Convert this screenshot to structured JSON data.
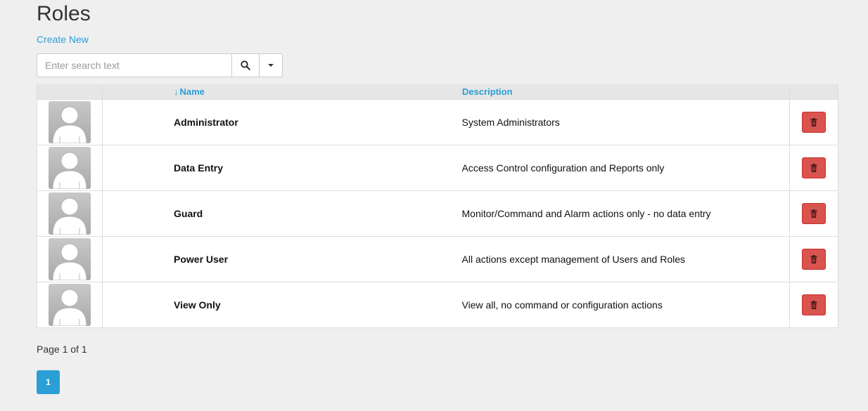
{
  "page": {
    "title": "Roles",
    "create_label": "Create New"
  },
  "search": {
    "placeholder": "Enter search text",
    "value": ""
  },
  "table": {
    "columns": {
      "name": "Name",
      "description": "Description"
    },
    "sort_icon": "sort-desc-arrow-icon",
    "rows": [
      {
        "name": "Administrator",
        "description": "System Administrators"
      },
      {
        "name": "Data Entry",
        "description": "Access Control configuration and Reports only"
      },
      {
        "name": "Guard",
        "description": "Monitor/Command and Alarm actions only - no data entry"
      },
      {
        "name": "Power User",
        "description": "All actions except management of Users and Roles"
      },
      {
        "name": "View Only",
        "description": "View all, no command or configuration actions"
      }
    ]
  },
  "pagination": {
    "info": "Page 1 of 1",
    "pages": [
      "1"
    ],
    "current": "1"
  },
  "colors": {
    "accent": "#2a9fd6",
    "danger": "#d9534f",
    "background": "#efefef"
  }
}
